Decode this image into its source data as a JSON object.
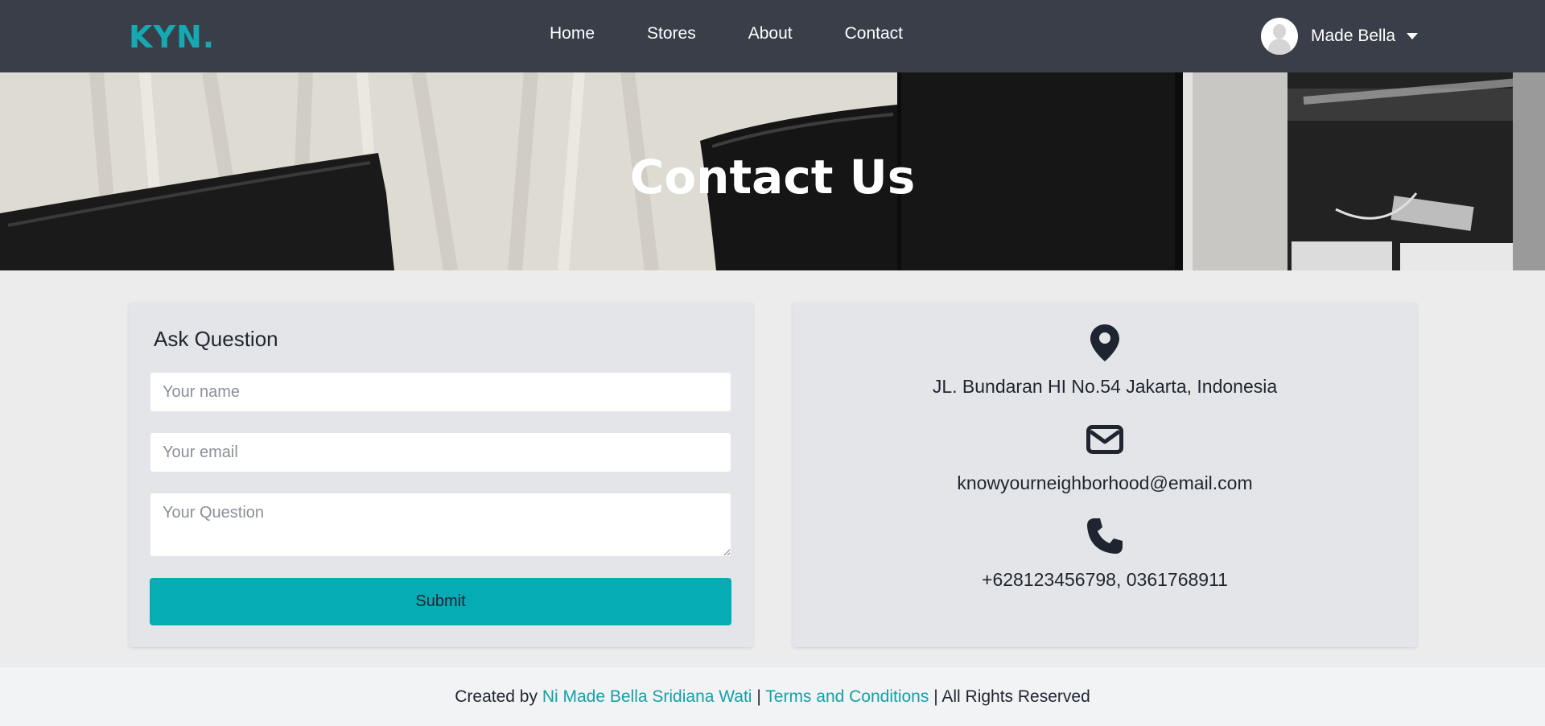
{
  "navbar": {
    "brand": "KYN.",
    "links": [
      "Home",
      "Stores",
      "About",
      "Contact"
    ],
    "user_name": "Made Bella"
  },
  "hero": {
    "title": "Contact Us"
  },
  "form": {
    "title": "Ask Question",
    "name_placeholder": "Your name",
    "email_placeholder": "Your email",
    "question_placeholder": "Your Question",
    "submit_label": "Submit"
  },
  "info": {
    "address": "JL. Bundaran HI No.54 Jakarta, Indonesia",
    "email": "knowyourneighborhood@email.com",
    "phone": "+628123456798, 0361768911",
    "icons": [
      "map-pin-icon",
      "envelope-icon",
      "phone-icon"
    ]
  },
  "footer": {
    "prefix": "Created by",
    "author": "Ni Made Bella Sridiana Wati",
    "separator": "|",
    "terms": "Terms and Conditions",
    "rights": "| All Rights Reserved"
  },
  "colors": {
    "navbar_bg": "#393e48",
    "accent": "#05acb4",
    "page_bg": "#ececec",
    "card_bg": "#e4e5e8",
    "footer_bg": "#f2f3f5"
  }
}
